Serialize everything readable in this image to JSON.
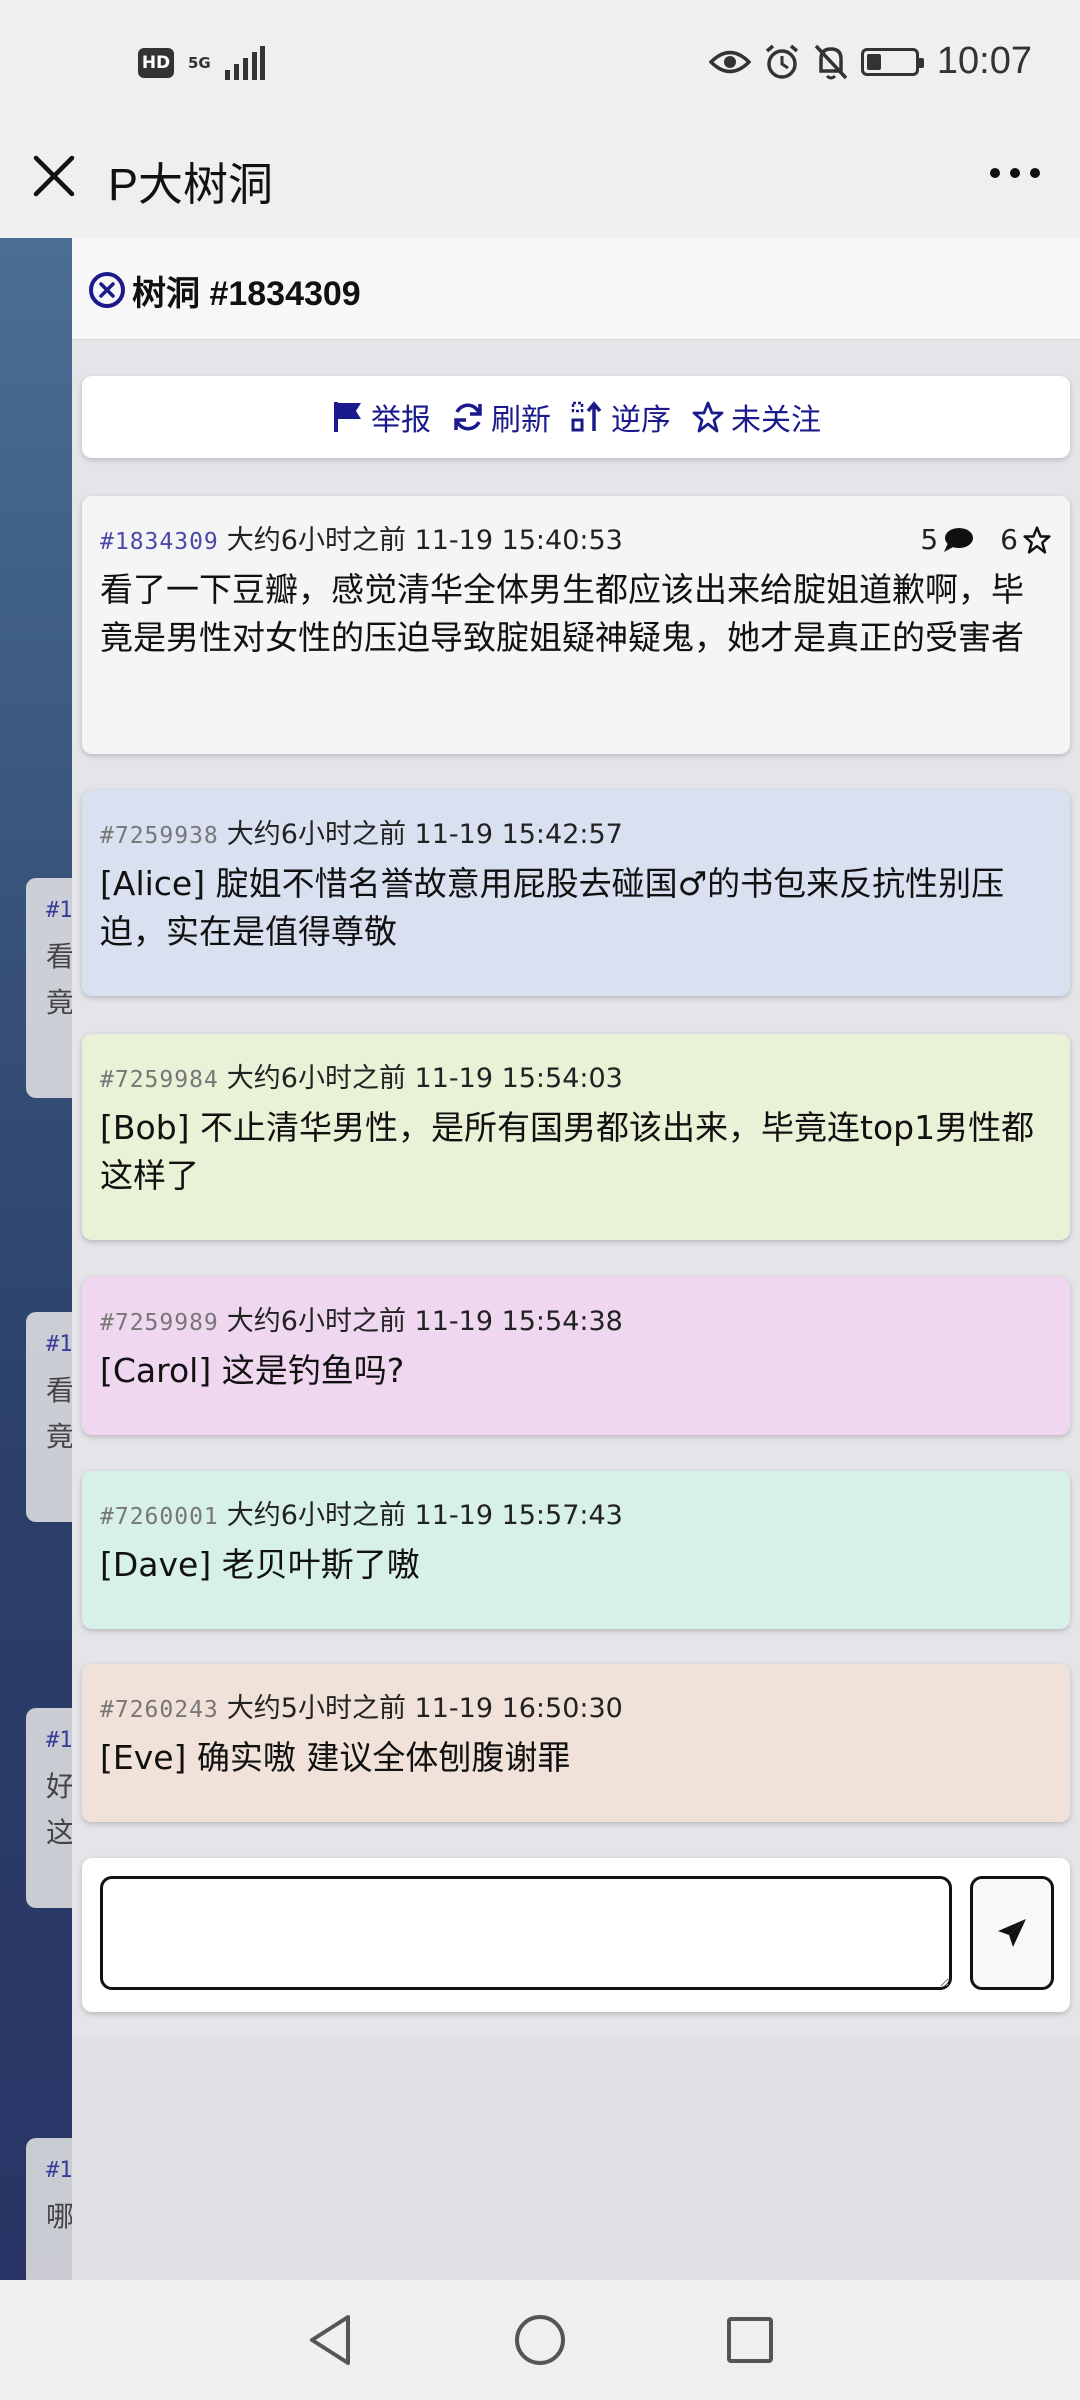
{
  "status_bar": {
    "hd_label": "HD",
    "network": "5G",
    "time": "10:07",
    "battery_level": 0.25
  },
  "app_bar": {
    "title": "P大树洞"
  },
  "background_cards": [
    {
      "id": "#1",
      "line1": "看",
      "line2": "竟"
    },
    {
      "id": "#1",
      "line1": "看",
      "line2": "竟"
    },
    {
      "id": "#1",
      "line1": "好",
      "line2": "这"
    },
    {
      "id": "#1",
      "line1": "哪",
      "line2": ""
    }
  ],
  "panel": {
    "title": "树洞 #1834309",
    "toolbar": {
      "report": "举报",
      "refresh": "刷新",
      "reverse": "逆序",
      "follow": "未关注"
    },
    "main_post": {
      "id": "#1834309",
      "time": "大约6小时之前 11-19 15:40:53",
      "reply_count": "5",
      "star_count": "6",
      "text": "看了一下豆瓣，感觉清华全体男生都应该出来给腚姐道歉啊，毕竟是男性对女性的压迫导致腚姐疑神疑鬼，她才是真正的受害者",
      "color": "#f5f5f5"
    },
    "replies": [
      {
        "id": "#7259938",
        "time": "大约6小时之前 11-19 15:42:57",
        "text": "[Alice] 腚姐不惜名誉故意用屁股去碰国♂的书包来反抗性别压迫，实在是值得尊敬",
        "color": "#d9e1f1"
      },
      {
        "id": "#7259984",
        "time": "大约6小时之前 11-19 15:54:03",
        "text": "[Bob] 不止清华男性，是所有国男都该出来，毕竟连top1男性都这样了",
        "color": "#e9f1d7"
      },
      {
        "id": "#7259989",
        "time": "大约6小时之前 11-19 15:54:38",
        "text": "[Carol] 这是钓鱼吗?",
        "color": "#f0d7f0"
      },
      {
        "id": "#7260001",
        "time": "大约6小时之前 11-19 15:57:43",
        "text": "[Dave] 老贝叶斯了嗷",
        "color": "#d7f0ea"
      },
      {
        "id": "#7260243",
        "time": "大约5小时之前 11-19 16:50:30",
        "text": "[Eve] 确实嗷 建议全体刨腹谢罪",
        "color": "#f0e2d9"
      }
    ],
    "reply_input": {
      "value": "",
      "placeholder": ""
    }
  },
  "colors": {
    "accent": "#1a1a8c",
    "status_bar_bg": "#efefef"
  }
}
